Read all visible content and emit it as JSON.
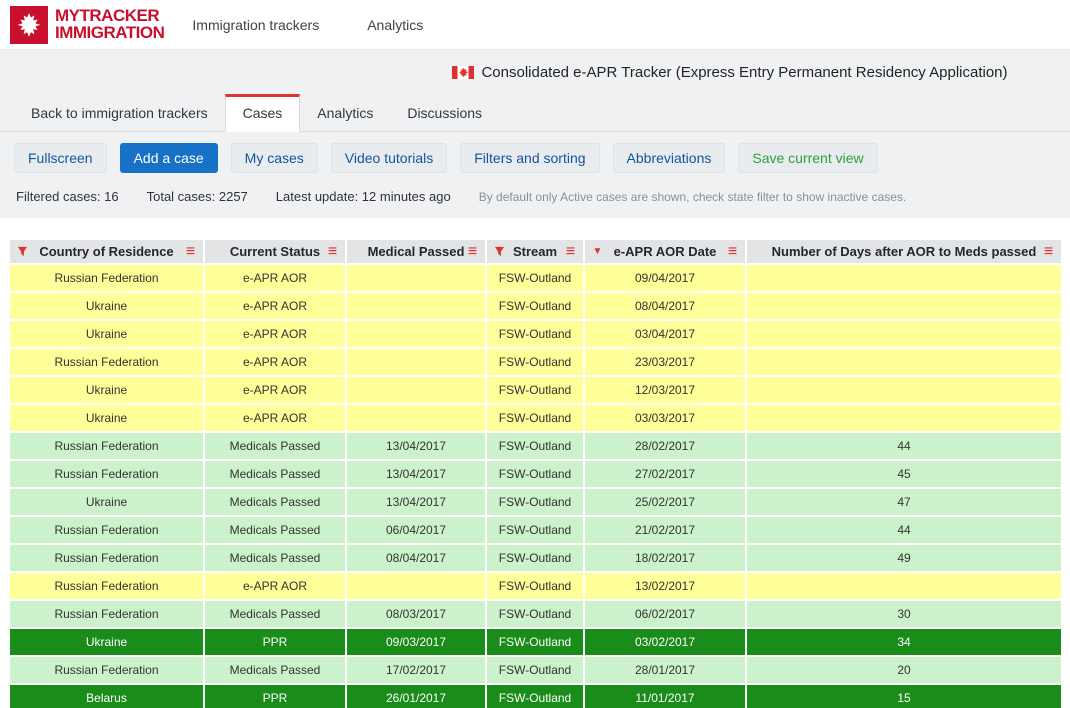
{
  "navbar": {
    "brand": {
      "line1": "MYTRACKER",
      "line2": "IMMIGRATION"
    },
    "items": [
      {
        "label": "Immigration trackers"
      },
      {
        "label": "Analytics"
      }
    ]
  },
  "header": {
    "title": "Consolidated e-APR Tracker (Express Entry Permanent Residency Application)"
  },
  "tabs": [
    {
      "label": "Back to immigration trackers",
      "active": false
    },
    {
      "label": "Cases",
      "active": true
    },
    {
      "label": "Analytics",
      "active": false
    },
    {
      "label": "Discussions",
      "active": false
    }
  ],
  "toolbar": {
    "buttons": [
      {
        "label": "Fullscreen",
        "style": "link"
      },
      {
        "label": "Add a case",
        "style": "primary"
      },
      {
        "label": "My cases",
        "style": "link"
      },
      {
        "label": "Video tutorials",
        "style": "link"
      },
      {
        "label": "Filters and sorting",
        "style": "link"
      },
      {
        "label": "Abbreviations",
        "style": "link"
      },
      {
        "label": "Save current view",
        "style": "success"
      }
    ]
  },
  "status": {
    "items": [
      "Filtered cases: 16",
      "Total cases: 2257",
      "Latest update: 12 minutes ago"
    ],
    "note": "By default only Active cases are shown, check state filter to show inactive cases."
  },
  "table": {
    "columns": [
      {
        "label": "Country of Residence",
        "filter": true,
        "sort": null,
        "menu": true
      },
      {
        "label": "Current Status",
        "filter": false,
        "sort": null,
        "menu": true
      },
      {
        "label": "Medical Passed",
        "filter": false,
        "sort": null,
        "menu": true
      },
      {
        "label": "Stream",
        "filter": true,
        "sort": null,
        "menu": true
      },
      {
        "label": "e-APR AOR Date",
        "filter": false,
        "sort": "desc",
        "menu": true
      },
      {
        "label": "Number of Days after AOR to Meds passed",
        "filter": false,
        "sort": null,
        "menu": true
      }
    ],
    "rows": [
      {
        "state": "aor",
        "cells": [
          "Russian Federation",
          "e-APR AOR",
          "",
          "FSW-Outland",
          "09/04/2017",
          ""
        ]
      },
      {
        "state": "aor",
        "cells": [
          "Ukraine",
          "e-APR AOR",
          "",
          "FSW-Outland",
          "08/04/2017",
          ""
        ]
      },
      {
        "state": "aor",
        "cells": [
          "Ukraine",
          "e-APR AOR",
          "",
          "FSW-Outland",
          "03/04/2017",
          ""
        ]
      },
      {
        "state": "aor",
        "cells": [
          "Russian Federation",
          "e-APR AOR",
          "",
          "FSW-Outland",
          "23/03/2017",
          ""
        ]
      },
      {
        "state": "aor",
        "cells": [
          "Ukraine",
          "e-APR AOR",
          "",
          "FSW-Outland",
          "12/03/2017",
          ""
        ]
      },
      {
        "state": "aor",
        "cells": [
          "Ukraine",
          "e-APR AOR",
          "",
          "FSW-Outland",
          "03/03/2017",
          ""
        ]
      },
      {
        "state": "meds",
        "cells": [
          "Russian Federation",
          "Medicals Passed",
          "13/04/2017",
          "FSW-Outland",
          "28/02/2017",
          "44"
        ]
      },
      {
        "state": "meds",
        "cells": [
          "Russian Federation",
          "Medicals Passed",
          "13/04/2017",
          "FSW-Outland",
          "27/02/2017",
          "45"
        ]
      },
      {
        "state": "meds",
        "cells": [
          "Ukraine",
          "Medicals Passed",
          "13/04/2017",
          "FSW-Outland",
          "25/02/2017",
          "47"
        ]
      },
      {
        "state": "meds",
        "cells": [
          "Russian Federation",
          "Medicals Passed",
          "06/04/2017",
          "FSW-Outland",
          "21/02/2017",
          "44"
        ]
      },
      {
        "state": "meds",
        "cells": [
          "Russian Federation",
          "Medicals Passed",
          "08/04/2017",
          "FSW-Outland",
          "18/02/2017",
          "49"
        ]
      },
      {
        "state": "aor",
        "cells": [
          "Russian Federation",
          "e-APR AOR",
          "",
          "FSW-Outland",
          "13/02/2017",
          ""
        ]
      },
      {
        "state": "meds",
        "cells": [
          "Russian Federation",
          "Medicals Passed",
          "08/03/2017",
          "FSW-Outland",
          "06/02/2017",
          "30"
        ]
      },
      {
        "state": "ppr",
        "cells": [
          "Ukraine",
          "PPR",
          "09/03/2017",
          "FSW-Outland",
          "03/02/2017",
          "34"
        ]
      },
      {
        "state": "meds",
        "cells": [
          "Russian Federation",
          "Medicals Passed",
          "17/02/2017",
          "FSW-Outland",
          "28/01/2017",
          "20"
        ]
      },
      {
        "state": "ppr",
        "cells": [
          "Belarus",
          "PPR",
          "26/01/2017",
          "FSW-Outland",
          "11/01/2017",
          "15"
        ]
      }
    ],
    "row_colors": {
      "aor": "#ffff99",
      "meds": "#ccf2cc",
      "ppr": "#1a8c1a"
    },
    "row_text_colors": {
      "aor": "#333333",
      "meds": "#333333",
      "ppr": "#ffffff"
    }
  },
  "colors": {
    "accent_red": "#c8102e",
    "icon_red": "#e03131",
    "primary_blue": "#1771c6",
    "link_blue": "#15539e",
    "success_green": "#2f9e44"
  }
}
